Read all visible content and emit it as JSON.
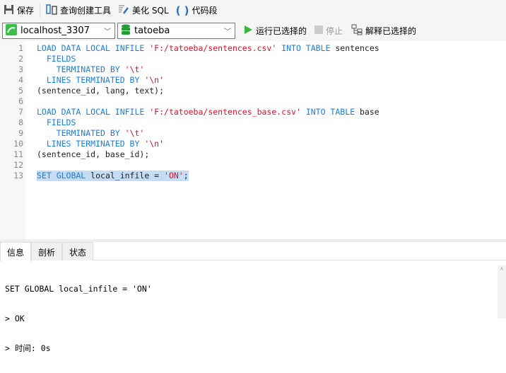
{
  "toolbar": {
    "save": "保存",
    "query_builder": "查询创建工具",
    "beautify": "美化 SQL",
    "snippet": "代码段"
  },
  "connection": {
    "server": "localhost_3307",
    "database": "tatoeba",
    "run_selected": "运行已选择的",
    "stop": "停止",
    "explain_selected": "解释已选择的"
  },
  "editor": {
    "lines": [
      [
        [
          "kw",
          "LOAD DATA LOCAL INFILE "
        ],
        [
          "str",
          "'F:/tatoeba/sentences.csv'"
        ],
        [
          "kw",
          " INTO TABLE "
        ],
        [
          "id",
          "sentences"
        ]
      ],
      [
        [
          "kw",
          "  FIELDS"
        ]
      ],
      [
        [
          "kw",
          "    TERMINATED BY "
        ],
        [
          "str",
          "'\\t'"
        ]
      ],
      [
        [
          "kw",
          "  LINES TERMINATED BY "
        ],
        [
          "str",
          "'\\n'"
        ]
      ],
      [
        [
          "id",
          "(sentence_id, lang, text);"
        ]
      ],
      [],
      [
        [
          "kw",
          "LOAD DATA LOCAL INFILE "
        ],
        [
          "str",
          "'F:/tatoeba/sentences_base.csv'"
        ],
        [
          "kw",
          " INTO TABLE "
        ],
        [
          "id",
          "base"
        ]
      ],
      [
        [
          "kw",
          "  FIELDS"
        ]
      ],
      [
        [
          "kw",
          "    TERMINATED BY "
        ],
        [
          "str",
          "'\\t'"
        ]
      ],
      [
        [
          "kw",
          "  LINES TERMINATED BY "
        ],
        [
          "str",
          "'\\n'"
        ]
      ],
      [
        [
          "id",
          "(sentence_id, base_id);"
        ]
      ],
      [],
      [
        [
          "kw",
          "SET GLOBAL "
        ],
        [
          "id",
          "local_infile = "
        ],
        [
          "str",
          "'ON'"
        ],
        [
          "id",
          ";"
        ]
      ]
    ],
    "selected_line": 13
  },
  "output": {
    "tabs": [
      "信息",
      "剖析",
      "状态"
    ],
    "active_tab": 0,
    "messages": [
      "SET GLOBAL local_infile = 'ON'",
      "> OK",
      "> 时间: 0s"
    ]
  }
}
